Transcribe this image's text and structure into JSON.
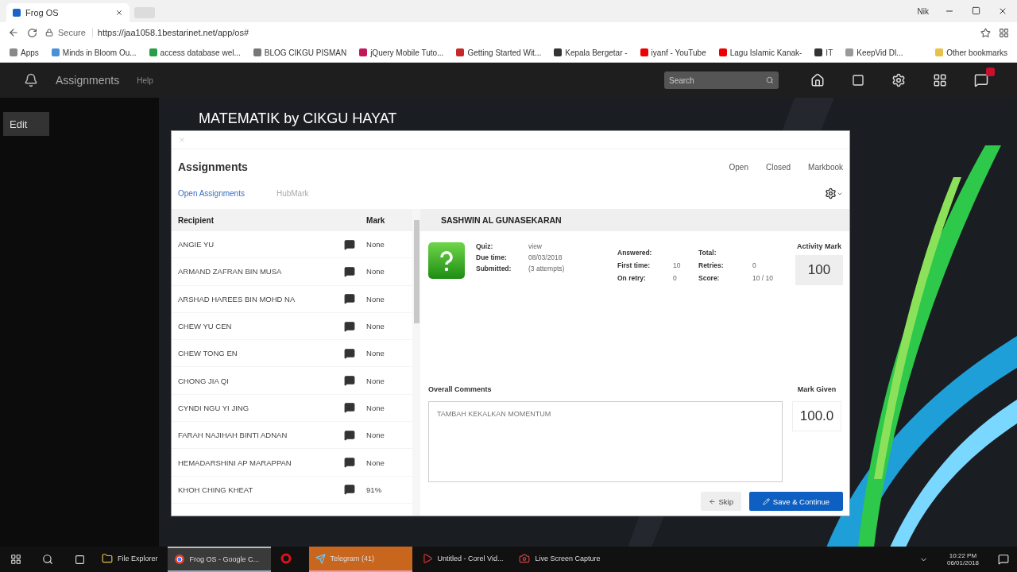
{
  "browser": {
    "tab_title": "Frog OS",
    "user": "Nik",
    "secure_label": "Secure",
    "url": "https://jaa1058.1bestarinet.net/app/os#",
    "bookmarks": [
      "Apps",
      "Minds in Bloom Ou...",
      "access database wel...",
      "BLOG CIKGU PISMAN",
      "jQuery Mobile Tuto...",
      "Getting Started Wit...",
      "Kepala Bergetar -",
      "iyanf - YouTube",
      "Lagu Islamic Kanak-",
      "IT",
      "KeepVid Dl..."
    ],
    "other_bookmarks": "Other bookmarks"
  },
  "app_bar": {
    "title": "Assignments",
    "help": "Help",
    "search": {
      "placeholder": "Search"
    }
  },
  "desktop": {
    "edit_button": "Edit",
    "page_title": "MATEMATIK by CIKGU HAYAT"
  },
  "dialog": {
    "title": "Assignments",
    "filters": [
      "Open",
      "Closed",
      "Markbook"
    ],
    "tabs": [
      {
        "label": "Open Assignments",
        "selected": true
      },
      {
        "label": "HubMark",
        "selected": false
      }
    ],
    "table": {
      "columns": [
        "Recipient",
        "Mark"
      ],
      "rows": [
        {
          "name": "ANGIE YU",
          "mark": "None"
        },
        {
          "name": "ARMAND ZAFRAN BIN MUSA",
          "mark": "None"
        },
        {
          "name": "ARSHAD HAREES BIN MOHD NA",
          "mark": "None"
        },
        {
          "name": "CHEW YU CEN",
          "mark": "None"
        },
        {
          "name": "CHEW TONG EN",
          "mark": "None"
        },
        {
          "name": "CHONG JIA QI",
          "mark": "None"
        },
        {
          "name": "CYNDI NGU YI JING",
          "mark": "None"
        },
        {
          "name": "FARAH NAJIHAH BINTI ADNAN",
          "mark": "None"
        },
        {
          "name": "HEMADARSHINI AP MARAPPAN",
          "mark": "None"
        },
        {
          "name": "KHOH CHING KHEAT",
          "mark": "91%"
        }
      ]
    },
    "student": {
      "name": "SASHWIN AL GUNASEKARAN",
      "details": [
        {
          "label": "Quiz:",
          "value": "view"
        },
        {
          "label": "Due time:",
          "value": "08/03/2018"
        },
        {
          "label": "Submitted:",
          "value": "(3 attempts)"
        }
      ],
      "stats": [
        {
          "label": "Answered:"
        },
        {
          "label": "Total:"
        },
        {
          "label": "First time:",
          "value": "10"
        },
        {
          "label": "Retries:",
          "value": "0"
        },
        {
          "label": "On retry:",
          "value": "0"
        },
        {
          "label": "Score:",
          "value": "10 / 10"
        }
      ],
      "activity_mark_label": "Activity Mark",
      "activity_mark": "100",
      "comments_label": "Overall Comments",
      "comments": "TAMBAH KEKALKAN MOMENTUM",
      "mark_given_label": "Mark Given",
      "mark_given": "100.0"
    },
    "buttons": [
      {
        "kind": "skip",
        "label": "Skip"
      },
      {
        "kind": "save",
        "label": "Save & Continue"
      }
    ]
  },
  "taskbar": {
    "apps": [
      {
        "label": "File Explorer",
        "kind": "folder",
        "selected": false,
        "highlighted": false
      },
      {
        "label": "Frog OS - Google C...",
        "kind": "browser",
        "selected": true,
        "highlighted": false
      },
      {
        "kind": "opera",
        "selected": false,
        "highlighted": false
      },
      {
        "label": "Telegram (41)",
        "kind": "telegram",
        "selected": false,
        "highlighted": true
      },
      {
        "label": "Untitled - Corel Vid...",
        "kind": "video",
        "selected": false,
        "highlighted": false
      },
      {
        "label": "Live Screen Capture",
        "kind": "capture",
        "selected": false,
        "highlighted": false
      }
    ],
    "time": "10:22 PM",
    "date": "06/01/2018"
  }
}
